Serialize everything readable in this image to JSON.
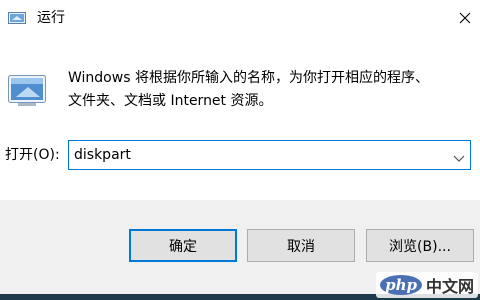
{
  "window": {
    "title": "运行"
  },
  "description": {
    "line1": "Windows 将根据你所输入的名称，为你打开相应的程序、",
    "line2": "文件夹、文档或 Internet 资源。"
  },
  "open_field": {
    "label": "打开(O):",
    "value": "diskpart"
  },
  "buttons": {
    "ok": "确定",
    "cancel": "取消",
    "browse": "浏览(B)..."
  },
  "watermark": {
    "logo": "php",
    "text": "中文网"
  },
  "colors": {
    "accent": "#0078d7",
    "footer_bg": "#f0f0f0",
    "button_bg": "#e1e1e1"
  },
  "icons": {
    "title": "run-dialog-icon",
    "app": "run-app-icon",
    "close": "close-icon",
    "dropdown": "chevron-down-icon"
  }
}
